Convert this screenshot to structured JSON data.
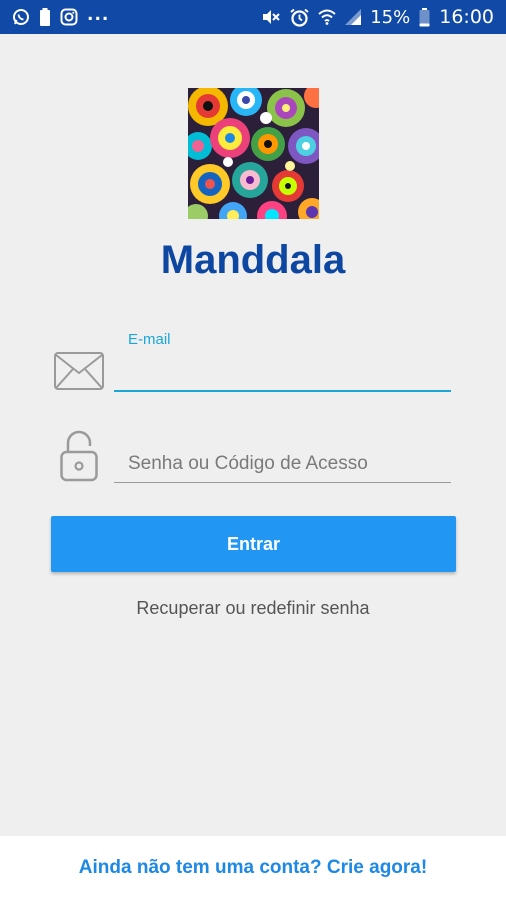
{
  "status_bar": {
    "overflow": "...",
    "battery": "15%",
    "time": "16:00",
    "left_icons": [
      "whatsapp-icon",
      "battery-notification-icon",
      "instagram-icon"
    ],
    "right_icons": [
      "mute-icon",
      "alarm-icon",
      "wifi-icon",
      "signal-icon",
      "battery-icon"
    ]
  },
  "app": {
    "title": "Manddala"
  },
  "login": {
    "email_label": "E-mail",
    "email_value": "",
    "password_placeholder": "Senha ou Código de Acesso",
    "submit_label": "Entrar",
    "recover_link": "Recuperar ou redefinir senha"
  },
  "footer": {
    "signup_link": "Ainda não tem uma conta? Crie agora!"
  },
  "colors": {
    "status_bar": "#1049a6",
    "title": "#0d47a1",
    "accent": "#1aa7d8",
    "button": "#2196f3",
    "link": "#1e88e5",
    "background": "#efefef"
  }
}
